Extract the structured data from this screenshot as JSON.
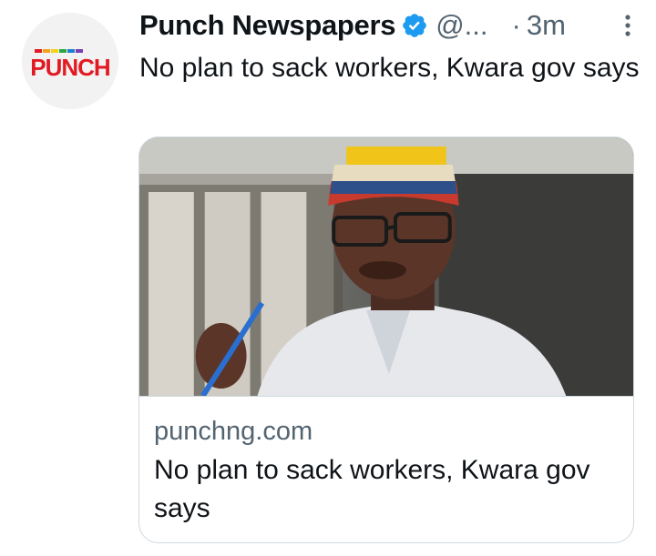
{
  "tweet": {
    "author_name": "Punch Newspapers",
    "handle": "@...",
    "separator": "·",
    "time": "3m",
    "text": "No plan to sack workers, Kwara gov says"
  },
  "avatar": {
    "logo_text": "PUNCH",
    "logo_color": "#e21b23"
  },
  "card": {
    "domain": "punchng.com",
    "title": "No plan to sack workers, Kwara gov says"
  },
  "icons": {
    "verified": "verified-badge-icon",
    "more": "more-options-icon"
  },
  "colors": {
    "text": "#0f1419",
    "secondary": "#536471",
    "verified_blue": "#1d9bf0",
    "border": "#cfd9de"
  }
}
